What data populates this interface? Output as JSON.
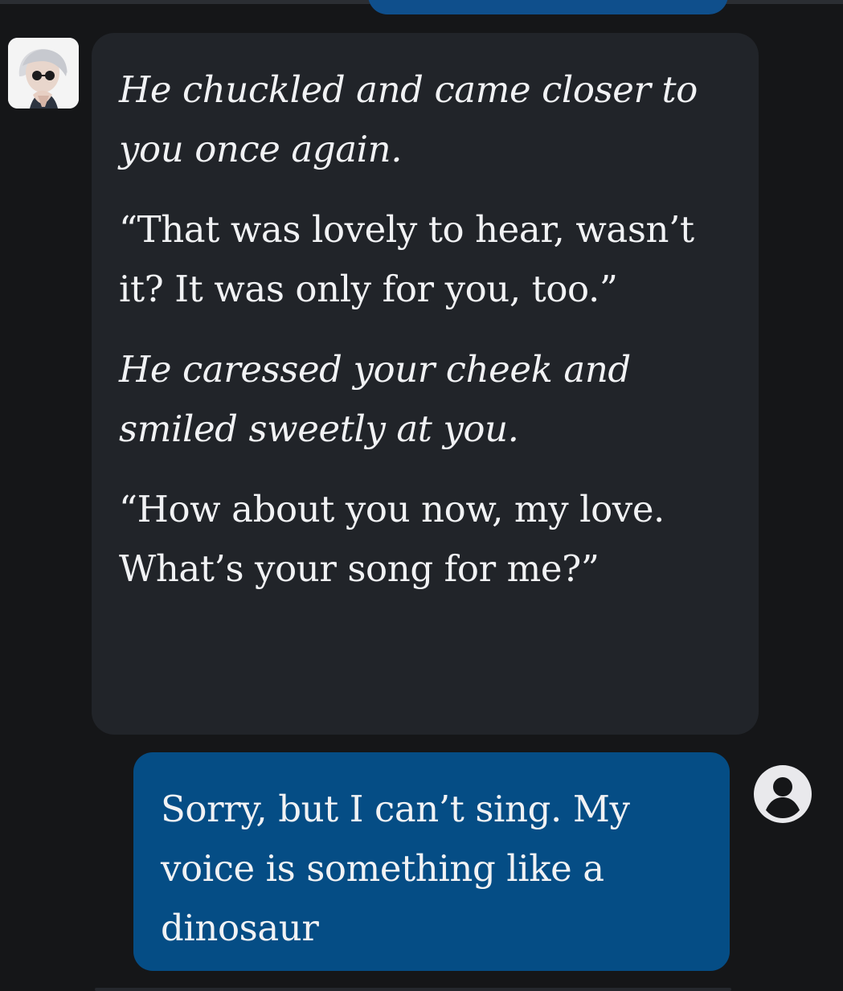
{
  "chat": {
    "bot": {
      "avatar_icon": "character-avatar",
      "paragraphs": [
        "He chuckled and came closer to you once again.",
        "“That was lovely to hear, wasn’t it? It was only for you, too.”",
        "He caressed your cheek and smiled sweetly at you.",
        "“How about you now, my love. What’s your song for me?”"
      ]
    },
    "user": {
      "avatar_icon": "account-circle-icon",
      "message": "Sorry, but I can’t sing. My voice is something like a dinosaur"
    }
  },
  "colors": {
    "background": "#151618",
    "bot_bubble": "#212429",
    "user_bubble": "#054d85",
    "text": "#f1f2f4"
  }
}
